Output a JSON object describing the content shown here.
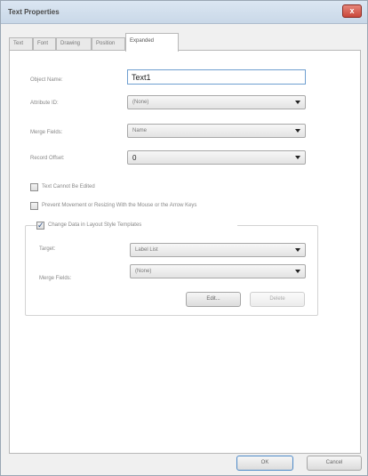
{
  "window": {
    "title": "Text Properties",
    "close_glyph": "x"
  },
  "tabs": [
    {
      "label": "Text",
      "active": false
    },
    {
      "label": "Font",
      "active": false
    },
    {
      "label": "Drawing",
      "active": false
    },
    {
      "label": "Position",
      "active": false
    },
    {
      "label": "Expanded",
      "active": true
    }
  ],
  "fields": {
    "object_name": {
      "label": "Object Name:",
      "value": "Text1"
    },
    "attribute_id": {
      "label": "Attribute ID:",
      "value": "(None)"
    },
    "merge_fields": {
      "label": "Merge Fields:",
      "value": "Name"
    },
    "record_offset": {
      "label": "Record Offset:",
      "value": "0"
    }
  },
  "checks": {
    "cannot_edit": {
      "label": "Text Cannot Be Edited",
      "checked": false
    },
    "prevent_move": {
      "label": "Prevent Movement or Resizing With the Mouse or the Arrow Keys",
      "checked": false
    }
  },
  "group": {
    "label": "Change Data in Layout Style Templates",
    "checked": true,
    "check_glyph": "✓",
    "target": {
      "label": "Target:",
      "value": "Label List"
    },
    "merge_fields": {
      "label": "Merge Fields:",
      "value": "(None)"
    },
    "edit_button": "Edit...",
    "delete_button": "Delete"
  },
  "buttons": {
    "ok": "OK",
    "cancel": "Cancel"
  }
}
